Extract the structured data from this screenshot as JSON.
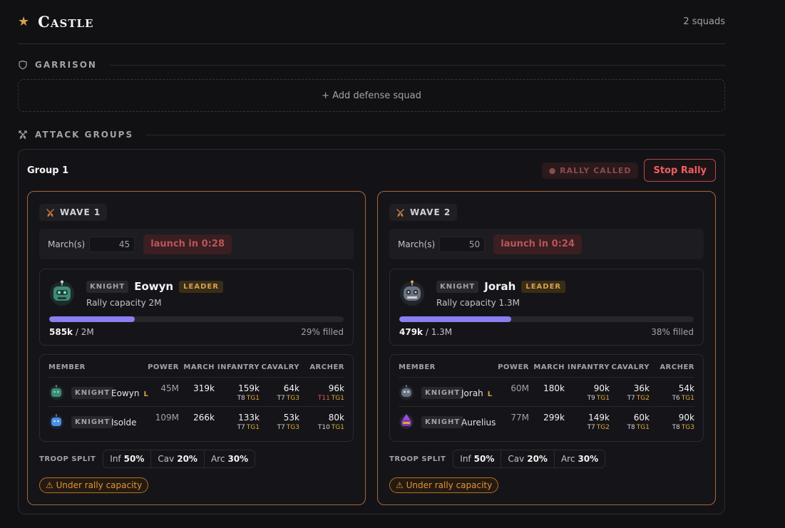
{
  "header": {
    "title": "Castle",
    "squad_count": "2 squads"
  },
  "garrison": {
    "label": "GARRISON",
    "add_label": "+ Add defense squad"
  },
  "attack": {
    "label": "ATTACK GROUPS"
  },
  "group": {
    "title": "Group 1",
    "rally_status": "● RALLY CALLED",
    "stop_label": "Stop Rally"
  },
  "table_headers": {
    "member": "MEMBER",
    "power": "POWER",
    "march": "MARCH",
    "infantry": "INFANTRY",
    "cavalry": "CAVALRY",
    "archer": "ARCHER"
  },
  "split_label": "TROOP SPLIT",
  "march_label": "March(s)",
  "waves": [
    {
      "label": "WAVE 1",
      "march_value": "45",
      "launch": "launch in 0:28",
      "leader": {
        "class": "KNIGHT",
        "name": "Eowyn",
        "badge": "LEADER",
        "capacity": "Rally capacity 2M",
        "filled": "585k",
        "total": "/ 2M",
        "fill_fraction": 0.29,
        "percent": "29% filled"
      },
      "members": [
        {
          "class": "KNIGHT",
          "name": "Eowyn",
          "leader_mark": "L",
          "power": "45M",
          "march": "319k",
          "inf": "159k",
          "inf_t": "T8",
          "inf_tg": "TG1",
          "cav": "64k",
          "cav_t": "T7",
          "cav_tg": "TG3",
          "arc": "96k",
          "arc_t": "T11",
          "arc_tg": "TG1"
        },
        {
          "class": "KNIGHT",
          "name": "Isolde",
          "leader_mark": "",
          "power": "109M",
          "march": "266k",
          "inf": "133k",
          "inf_t": "T7",
          "inf_tg": "TG1",
          "cav": "53k",
          "cav_t": "T7",
          "cav_tg": "TG3",
          "arc": "80k",
          "arc_t": "T10",
          "arc_tg": "TG1"
        }
      ],
      "split": {
        "inf_label": "Inf",
        "inf": "50%",
        "cav_label": "Cav",
        "cav": "20%",
        "arc_label": "Arc",
        "arc": "30%"
      },
      "warning": "⚠ Under rally capacity"
    },
    {
      "label": "WAVE 2",
      "march_value": "50",
      "launch": "launch in 0:24",
      "leader": {
        "class": "KNIGHT",
        "name": "Jorah",
        "badge": "LEADER",
        "capacity": "Rally capacity 1.3M",
        "filled": "479k",
        "total": "/ 1.3M",
        "fill_fraction": 0.38,
        "percent": "38% filled"
      },
      "members": [
        {
          "class": "KNIGHT",
          "name": "Jorah",
          "leader_mark": "L",
          "power": "60M",
          "march": "180k",
          "inf": "90k",
          "inf_t": "T9",
          "inf_tg": "TG1",
          "cav": "36k",
          "cav_t": "T7",
          "cav_tg": "TG2",
          "arc": "54k",
          "arc_t": "T6",
          "arc_tg": "TG1"
        },
        {
          "class": "KNIGHT",
          "name": "Aurelius",
          "leader_mark": "",
          "power": "77M",
          "march": "299k",
          "inf": "149k",
          "inf_t": "T7",
          "inf_tg": "TG2",
          "cav": "60k",
          "cav_t": "T8",
          "cav_tg": "TG1",
          "arc": "90k",
          "arc_t": "T8",
          "arc_tg": "TG3"
        }
      ],
      "split": {
        "inf_label": "Inf",
        "inf": "50%",
        "cav_label": "Cav",
        "cav": "20%",
        "arc_label": "Arc",
        "arc": "30%"
      },
      "warning": "⚠ Under rally capacity"
    }
  ],
  "colors": {
    "accent_gold": "#d4a24c",
    "wave_border": "#a8663a",
    "progress": "#8b7ef0",
    "danger": "#ef5f63",
    "tier_gold": "#e0a935",
    "tier_red": "#e05a4e"
  }
}
